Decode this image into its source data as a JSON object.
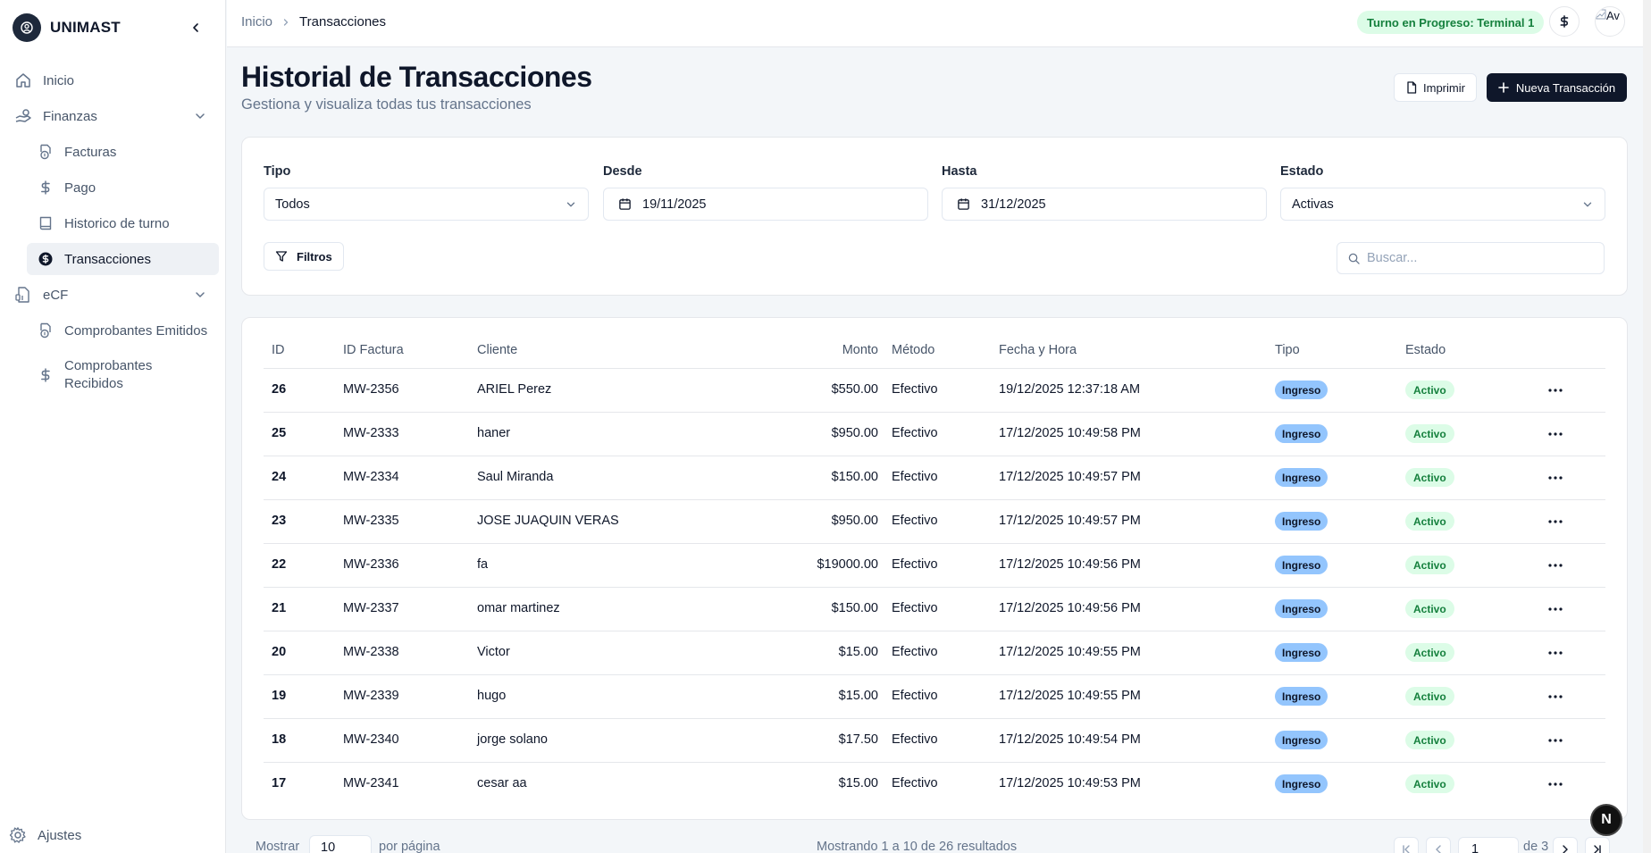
{
  "app": {
    "name": "UNIMAST"
  },
  "sidebar": {
    "items": [
      {
        "label": "Inicio"
      },
      {
        "label": "Finanzas"
      },
      {
        "label": "Facturas"
      },
      {
        "label": "Pago"
      },
      {
        "label": "Historico de turno"
      },
      {
        "label": "Transacciones"
      },
      {
        "label": "eCF"
      },
      {
        "label": "Comprobantes Emitidos"
      },
      {
        "label": "Comprobantes Recibidos"
      }
    ],
    "settings_label": "Ajustes"
  },
  "topbar": {
    "breadcrumb": {
      "home": "Inicio",
      "current": "Transacciones"
    },
    "shift_badge": "Turno en Progreso: Terminal 1",
    "avatar_alt": "Av"
  },
  "header": {
    "title": "Historial de Transacciones",
    "subtitle": "Gestiona y visualiza todas tus transacciones",
    "print_label": "Imprimir",
    "new_label": "Nueva Transacción"
  },
  "filters": {
    "tipo": {
      "label": "Tipo",
      "value": "Todos"
    },
    "desde": {
      "label": "Desde",
      "value": "19/11/2025"
    },
    "hasta": {
      "label": "Hasta",
      "value": "31/12/2025"
    },
    "estado": {
      "label": "Estado",
      "value": "Activas"
    },
    "filters_button": "Filtros",
    "search_placeholder": "Buscar..."
  },
  "table": {
    "columns": [
      "ID",
      "ID Factura",
      "Cliente",
      "Monto",
      "Método",
      "Fecha y Hora",
      "Tipo",
      "Estado"
    ],
    "rows": [
      {
        "id": "26",
        "invoice": "MW-2356",
        "client": "ARIEL Perez",
        "amount": "$550.00",
        "method": "Efectivo",
        "datetime": "19/12/2025 12:37:18 AM",
        "type": "Ingreso",
        "status": "Activo"
      },
      {
        "id": "25",
        "invoice": "MW-2333",
        "client": "haner",
        "amount": "$950.00",
        "method": "Efectivo",
        "datetime": "17/12/2025 10:49:58 PM",
        "type": "Ingreso",
        "status": "Activo"
      },
      {
        "id": "24",
        "invoice": "MW-2334",
        "client": "Saul Miranda",
        "amount": "$150.00",
        "method": "Efectivo",
        "datetime": "17/12/2025 10:49:57 PM",
        "type": "Ingreso",
        "status": "Activo"
      },
      {
        "id": "23",
        "invoice": "MW-2335",
        "client": "JOSE JUAQUIN VERAS",
        "amount": "$950.00",
        "method": "Efectivo",
        "datetime": "17/12/2025 10:49:57 PM",
        "type": "Ingreso",
        "status": "Activo"
      },
      {
        "id": "22",
        "invoice": "MW-2336",
        "client": "fa",
        "amount": "$19000.00",
        "method": "Efectivo",
        "datetime": "17/12/2025 10:49:56 PM",
        "type": "Ingreso",
        "status": "Activo"
      },
      {
        "id": "21",
        "invoice": "MW-2337",
        "client": "omar martinez",
        "amount": "$150.00",
        "method": "Efectivo",
        "datetime": "17/12/2025 10:49:56 PM",
        "type": "Ingreso",
        "status": "Activo"
      },
      {
        "id": "20",
        "invoice": "MW-2338",
        "client": "Victor",
        "amount": "$15.00",
        "method": "Efectivo",
        "datetime": "17/12/2025 10:49:55 PM",
        "type": "Ingreso",
        "status": "Activo"
      },
      {
        "id": "19",
        "invoice": "MW-2339",
        "client": "hugo",
        "amount": "$15.00",
        "method": "Efectivo",
        "datetime": "17/12/2025 10:49:55 PM",
        "type": "Ingreso",
        "status": "Activo"
      },
      {
        "id": "18",
        "invoice": "MW-2340",
        "client": "jorge solano",
        "amount": "$17.50",
        "method": "Efectivo",
        "datetime": "17/12/2025 10:49:54 PM",
        "type": "Ingreso",
        "status": "Activo"
      },
      {
        "id": "17",
        "invoice": "MW-2341",
        "client": "cesar aa",
        "amount": "$15.00",
        "method": "Efectivo",
        "datetime": "17/12/2025 10:49:53 PM",
        "type": "Ingreso",
        "status": "Activo"
      }
    ]
  },
  "pagination": {
    "show_label": "Mostrar",
    "page_size": "10",
    "per_page_label": "por página",
    "summary": "Mostrando 1 a 10 de 26 resultados",
    "current_page": "1",
    "of_label": "de 3"
  },
  "fab_label": "N",
  "colors": {
    "primary": "#0f172a",
    "type_badge": "#93c5fd",
    "status_badge_bg": "#dcfce7",
    "status_badge_text": "#15803d"
  }
}
